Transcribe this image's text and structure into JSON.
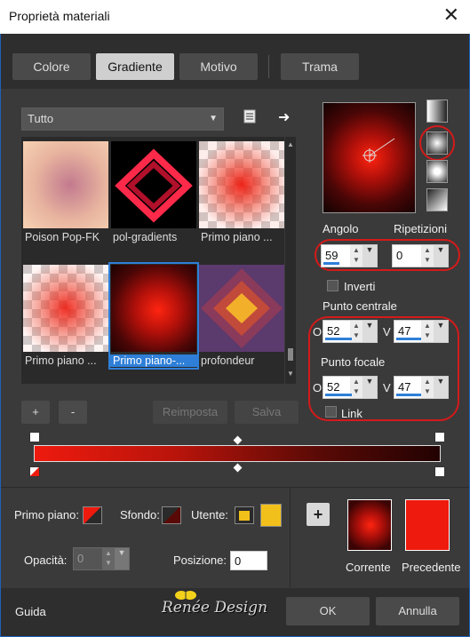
{
  "window": {
    "title": "Proprietà materiali"
  },
  "tabs": [
    {
      "label": "Colore",
      "active": false
    },
    {
      "label": "Gradiente",
      "active": true
    },
    {
      "label": "Motivo",
      "active": false
    },
    {
      "label": "Trama",
      "active": false
    }
  ],
  "category_dropdown": {
    "value": "Tutto"
  },
  "gallery": [
    {
      "label": "Poison Pop-FK"
    },
    {
      "label": "pol-gradients"
    },
    {
      "label": "Primo piano ..."
    },
    {
      "label": "Primo piano ..."
    },
    {
      "label": "Primo piano-...",
      "selected": true
    },
    {
      "label": "profondeur"
    }
  ],
  "buttons": {
    "add": "+",
    "remove": "-",
    "reset": "Reimposta",
    "save": "Salva"
  },
  "angle": {
    "label": "Angolo",
    "value": "59"
  },
  "repeats": {
    "label": "Ripetizioni",
    "value": "0"
  },
  "invert": {
    "label": "Inverti",
    "checked": false
  },
  "center_point": {
    "label": "Punto centrale",
    "h_label": "O",
    "h_value": "52",
    "v_label": "V",
    "v_value": "47"
  },
  "focal_point": {
    "label": "Punto focale",
    "h_label": "O",
    "h_value": "52",
    "v_label": "V",
    "v_value": "47"
  },
  "link": {
    "label": "Link",
    "checked": false
  },
  "bottom": {
    "foreground_label": "Primo piano:",
    "background_label": "Sfondo:",
    "user_label": "Utente:",
    "opacity_label": "Opacità:",
    "opacity_value": "0",
    "position_label": "Posizione:",
    "position_value": "0",
    "current_label": "Corrente",
    "previous_label": "Precedente"
  },
  "footer": {
    "help": "Guida",
    "ok": "OK",
    "cancel": "Annulla",
    "watermark": "Renée Design"
  },
  "colors": {
    "accent": "#2f7fd8",
    "highlight_circle": "#d41a1a",
    "previous_swatch": "#ee1a0e",
    "user_swatch": "#f2c01a"
  }
}
